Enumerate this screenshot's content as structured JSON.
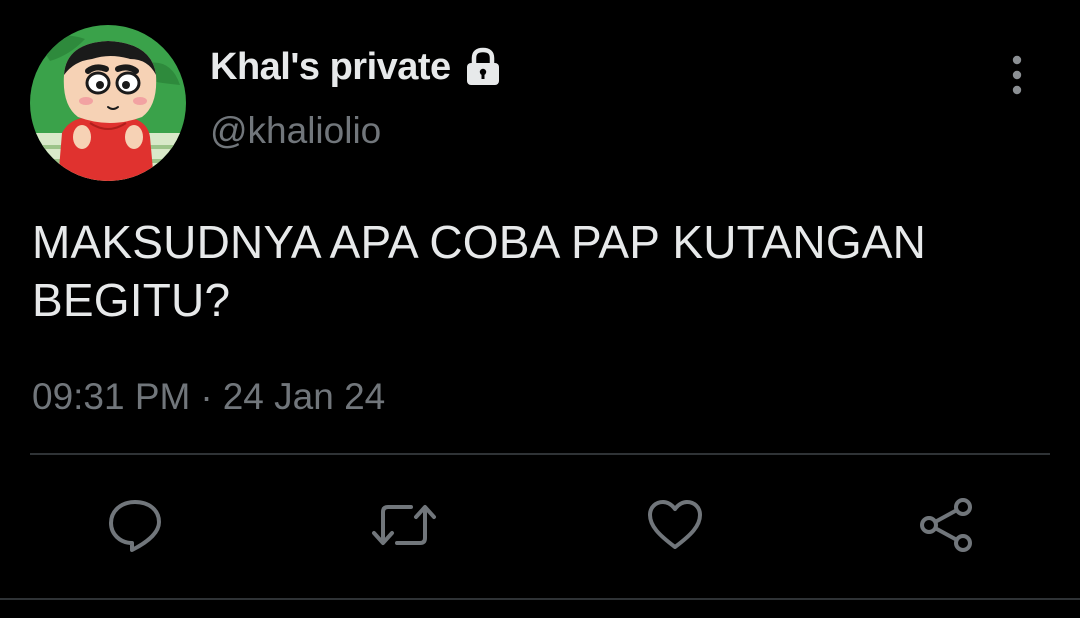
{
  "tweet": {
    "display_name": "Khal's private",
    "handle": "@khaliolio",
    "text": "MAKSUDNYA APA COBA PAP KUTANGAN BEGITU?",
    "time": "09:31 PM",
    "separator": "·",
    "date": "24 Jan 24",
    "protected": true
  },
  "icons": {
    "lock": "lock-icon",
    "more": "more-vertical-icon",
    "reply": "reply-icon",
    "retweet": "retweet-icon",
    "like": "heart-icon",
    "share": "share-icon"
  },
  "colors": {
    "background": "#000000",
    "primary_text": "#e7e9ea",
    "secondary_text": "#71767b",
    "divider": "#2f3336"
  }
}
